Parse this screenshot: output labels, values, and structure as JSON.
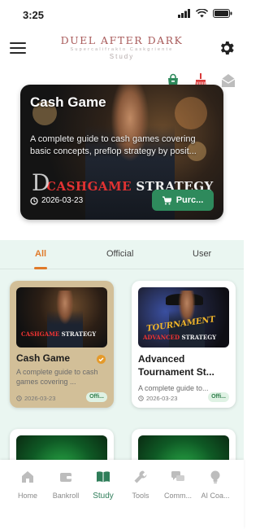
{
  "status": {
    "time": "3:25"
  },
  "header": {
    "title": "DUEL AFTER DARK",
    "subtitle": "Supercalifrakto Caskgriente",
    "section": "Study"
  },
  "hero": {
    "title": "Cash Game",
    "description": "A complete guide to cash games covering basic concepts, preflop strategy by posit...",
    "logo_text_red": "CASHGAME",
    "logo_text_white": "STRATEGY",
    "date": "2026-03-23",
    "buy_label": "Purc..."
  },
  "tabs": [
    {
      "label": "All",
      "active": true
    },
    {
      "label": "Official",
      "active": false
    },
    {
      "label": "User",
      "active": false
    }
  ],
  "cards": [
    {
      "title": "Cash Game",
      "description": "A complete guide to cash games covering ...",
      "date": "2026-03-23",
      "badge": "Offi...",
      "logo_red": "CASHGAME",
      "logo_white": "STRATEGY"
    },
    {
      "title": "Advanced Tournament St...",
      "description": "A complete guide to...",
      "date": "2026-03-23",
      "badge": "Offi...",
      "logo_top": "TOURNAMENT",
      "logo_red": "ADVANCED",
      "logo_white": "STRATEGY"
    }
  ],
  "nav": [
    {
      "label": "Home",
      "icon": "home-icon"
    },
    {
      "label": "Bankroll",
      "icon": "wallet-icon"
    },
    {
      "label": "Study",
      "icon": "book-icon",
      "active": true
    },
    {
      "label": "Tools",
      "icon": "wrench-icon"
    },
    {
      "label": "Comm...",
      "icon": "chat-icon"
    },
    {
      "label": "AI Coa...",
      "icon": "bulb-icon"
    }
  ],
  "colors": {
    "accent": "#2e8a5c",
    "tab_active": "#e07a2a",
    "panel_bg": "#eaf6f1",
    "brand": "#a85a5a"
  }
}
